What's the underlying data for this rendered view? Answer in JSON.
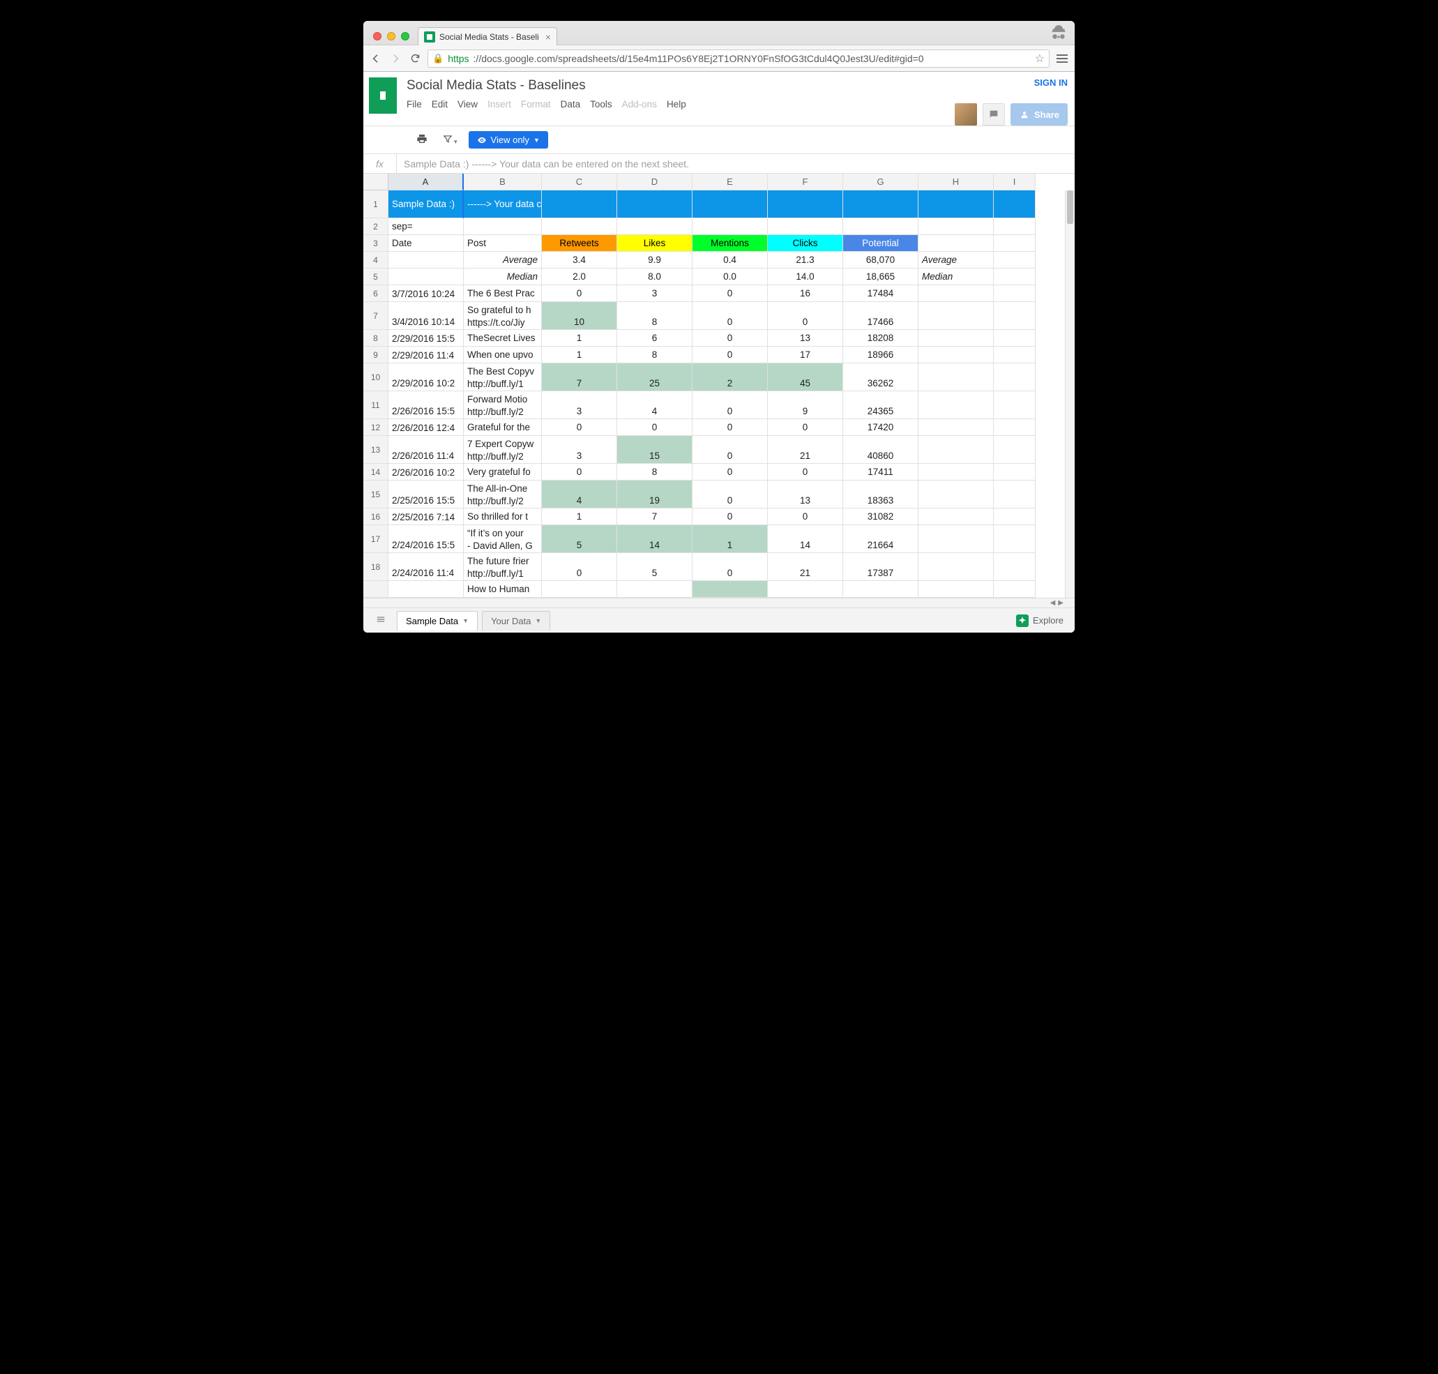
{
  "browser": {
    "tab_title": "Social Media Stats - Baseli",
    "url_https": "https",
    "url_rest": "://docs.google.com/spreadsheets/d/15e4m11POs6Y8Ej2T1ORNY0FnSfOG3tCdul4Q0Jest3U/edit#gid=0"
  },
  "doc": {
    "title": "Social Media Stats - Baselines",
    "signin": "SIGN IN",
    "share": "Share"
  },
  "menu": {
    "file": "File",
    "edit": "Edit",
    "view": "View",
    "insert": "Insert",
    "format": "Format",
    "data": "Data",
    "tools": "Tools",
    "addons": "Add-ons",
    "help": "Help"
  },
  "toolbar": {
    "view_only": "View only"
  },
  "fx": {
    "label": "fx",
    "content": "Sample Data :)  ------> Your data can be entered on the next sheet."
  },
  "columns": [
    "A",
    "B",
    "C",
    "D",
    "E",
    "F",
    "G",
    "H",
    "I"
  ],
  "banner": {
    "a": "Sample Data :)",
    "b": "------> Your data can be entered on the next sheet."
  },
  "row2": {
    "a": "sep="
  },
  "headers": {
    "date": "Date",
    "post": "Post",
    "retweets": "Retweets",
    "likes": "Likes",
    "mentions": "Mentions",
    "clicks": "Clicks",
    "potential": "Potential"
  },
  "stats": {
    "avg_label": "Average",
    "med_label": "Median",
    "avg": {
      "retweets": "3.4",
      "likes": "9.9",
      "mentions": "0.4",
      "clicks": "21.3",
      "potential": "68,070"
    },
    "med": {
      "retweets": "2.0",
      "likes": "8.0",
      "mentions": "0.0",
      "clicks": "14.0",
      "potential": "18,665"
    },
    "avg_label_r": "Average",
    "med_label_r": "Median"
  },
  "rows": [
    {
      "n": "6",
      "date": "3/7/2016 10:24",
      "post": "The 6 Best Prac",
      "rt": "0",
      "lk": "3",
      "mn": "0",
      "ck": "16",
      "pt": "17484",
      "hl": []
    },
    {
      "n": "7",
      "date": "3/4/2016 10:14",
      "post": "So grateful to h\nhttps://t.co/Jiy",
      "rt": "10",
      "lk": "8",
      "mn": "0",
      "ck": "0",
      "pt": "17466",
      "hl": [
        "rt"
      ]
    },
    {
      "n": "8",
      "date": "2/29/2016 15:5",
      "post": "TheSecret Lives",
      "rt": "1",
      "lk": "6",
      "mn": "0",
      "ck": "13",
      "pt": "18208",
      "hl": []
    },
    {
      "n": "9",
      "date": "2/29/2016 11:4",
      "post": "When one upvo",
      "rt": "1",
      "lk": "8",
      "mn": "0",
      "ck": "17",
      "pt": "18966",
      "hl": []
    },
    {
      "n": "10",
      "date": "2/29/2016 10:2",
      "post": "The Best Copyv\nhttp://buff.ly/1",
      "rt": "7",
      "lk": "25",
      "mn": "2",
      "ck": "45",
      "pt": "36262",
      "hl": [
        "rt",
        "lk",
        "mn",
        "ck"
      ]
    },
    {
      "n": "11",
      "date": "2/26/2016 15:5",
      "post": "Forward Motio\nhttp://buff.ly/2",
      "rt": "3",
      "lk": "4",
      "mn": "0",
      "ck": "9",
      "pt": "24365",
      "hl": []
    },
    {
      "n": "12",
      "date": "2/26/2016 12:4",
      "post": "Grateful for the",
      "rt": "0",
      "lk": "0",
      "mn": "0",
      "ck": "0",
      "pt": "17420",
      "hl": []
    },
    {
      "n": "13",
      "date": "2/26/2016 11:4",
      "post": "7 Expert Copyw\nhttp://buff.ly/2",
      "rt": "3",
      "lk": "15",
      "mn": "0",
      "ck": "21",
      "pt": "40860",
      "hl": [
        "lk"
      ]
    },
    {
      "n": "14",
      "date": "2/26/2016 10:2",
      "post": "Very grateful fo",
      "rt": "0",
      "lk": "8",
      "mn": "0",
      "ck": "0",
      "pt": "17411",
      "hl": []
    },
    {
      "n": "15",
      "date": "2/25/2016 15:5",
      "post": "The All-in-One\nhttp://buff.ly/2",
      "rt": "4",
      "lk": "19",
      "mn": "0",
      "ck": "13",
      "pt": "18363",
      "hl": [
        "rt",
        "lk"
      ]
    },
    {
      "n": "16",
      "date": "2/25/2016 7:14",
      "post": "So thrilled for t",
      "rt": "1",
      "lk": "7",
      "mn": "0",
      "ck": "0",
      "pt": "31082",
      "hl": []
    },
    {
      "n": "17",
      "date": "2/24/2016 15:5",
      "post": "“If it’s on your \n- David Allen, G",
      "rt": "5",
      "lk": "14",
      "mn": "1",
      "ck": "14",
      "pt": "21664",
      "hl": [
        "rt",
        "lk",
        "mn"
      ]
    },
    {
      "n": "18",
      "date": "2/24/2016 11:4",
      "post": "The future frier\nhttp://buff.ly/1",
      "rt": "0",
      "lk": "5",
      "mn": "0",
      "ck": "21",
      "pt": "17387",
      "hl": []
    },
    {
      "n": "",
      "date": "",
      "post": "How to Human",
      "rt": "",
      "lk": "",
      "mn": "",
      "ck": "",
      "pt": "",
      "hl": [
        "mn"
      ]
    }
  ],
  "sheets": {
    "active": "Sample Data",
    "other": "Your Data",
    "explore": "Explore"
  },
  "chart_data": {
    "type": "table",
    "title": "Social Media Stats - Baselines",
    "columns": [
      "Date",
      "Post",
      "Retweets",
      "Likes",
      "Mentions",
      "Clicks",
      "Potential"
    ],
    "summary": {
      "Average": {
        "Retweets": 3.4,
        "Likes": 9.9,
        "Mentions": 0.4,
        "Clicks": 21.3,
        "Potential": 68070
      },
      "Median": {
        "Retweets": 2.0,
        "Likes": 8.0,
        "Mentions": 0.0,
        "Clicks": 14.0,
        "Potential": 18665
      }
    },
    "rows": [
      {
        "Date": "3/7/2016 10:24",
        "Retweets": 0,
        "Likes": 3,
        "Mentions": 0,
        "Clicks": 16,
        "Potential": 17484
      },
      {
        "Date": "3/4/2016 10:14",
        "Retweets": 10,
        "Likes": 8,
        "Mentions": 0,
        "Clicks": 0,
        "Potential": 17466
      },
      {
        "Date": "2/29/2016 15:5",
        "Retweets": 1,
        "Likes": 6,
        "Mentions": 0,
        "Clicks": 13,
        "Potential": 18208
      },
      {
        "Date": "2/29/2016 11:4",
        "Retweets": 1,
        "Likes": 8,
        "Mentions": 0,
        "Clicks": 17,
        "Potential": 18966
      },
      {
        "Date": "2/29/2016 10:2",
        "Retweets": 7,
        "Likes": 25,
        "Mentions": 2,
        "Clicks": 45,
        "Potential": 36262
      },
      {
        "Date": "2/26/2016 15:5",
        "Retweets": 3,
        "Likes": 4,
        "Mentions": 0,
        "Clicks": 9,
        "Potential": 24365
      },
      {
        "Date": "2/26/2016 12:4",
        "Retweets": 0,
        "Likes": 0,
        "Mentions": 0,
        "Clicks": 0,
        "Potential": 17420
      },
      {
        "Date": "2/26/2016 11:4",
        "Retweets": 3,
        "Likes": 15,
        "Mentions": 0,
        "Clicks": 21,
        "Potential": 40860
      },
      {
        "Date": "2/26/2016 10:2",
        "Retweets": 0,
        "Likes": 8,
        "Mentions": 0,
        "Clicks": 0,
        "Potential": 17411
      },
      {
        "Date": "2/25/2016 15:5",
        "Retweets": 4,
        "Likes": 19,
        "Mentions": 0,
        "Clicks": 13,
        "Potential": 18363
      },
      {
        "Date": "2/25/2016 7:14",
        "Retweets": 1,
        "Likes": 7,
        "Mentions": 0,
        "Clicks": 0,
        "Potential": 31082
      },
      {
        "Date": "2/24/2016 15:5",
        "Retweets": 5,
        "Likes": 14,
        "Mentions": 1,
        "Clicks": 14,
        "Potential": 21664
      },
      {
        "Date": "2/24/2016 11:4",
        "Retweets": 0,
        "Likes": 5,
        "Mentions": 0,
        "Clicks": 21,
        "Potential": 17387
      }
    ]
  }
}
